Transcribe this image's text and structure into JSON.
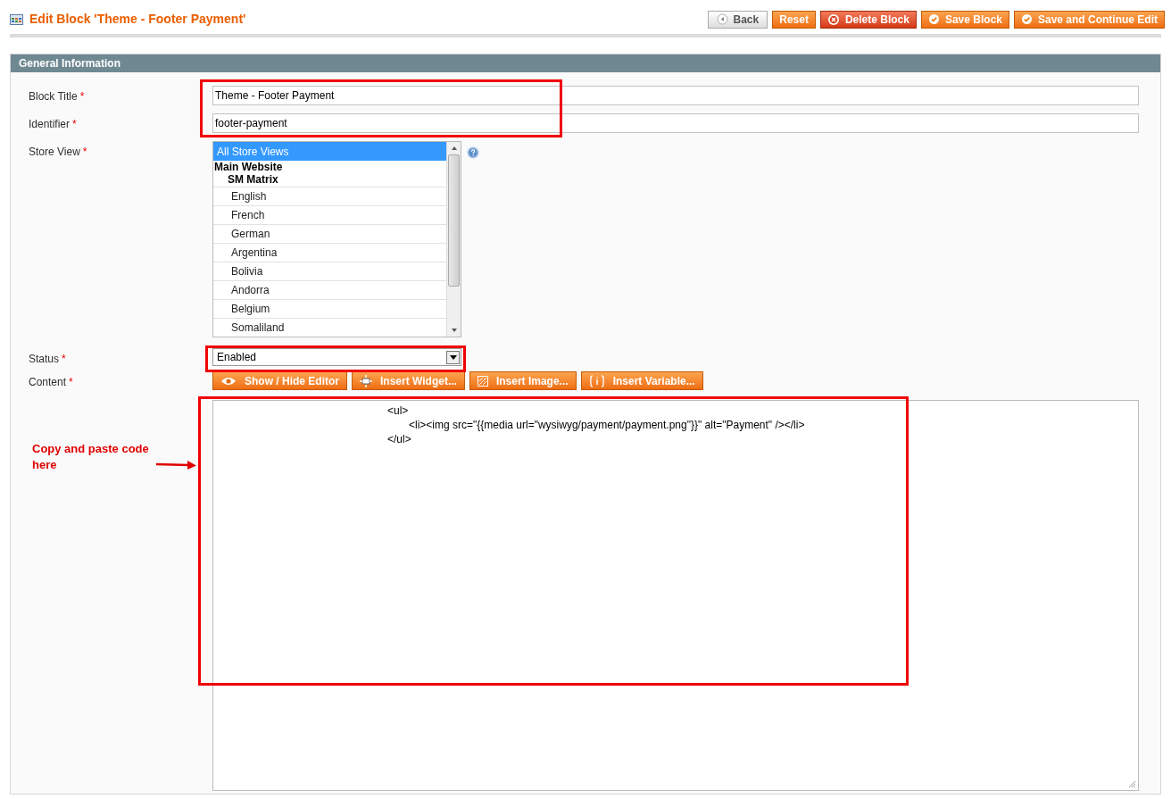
{
  "page_title": "Edit Block 'Theme - Footer Payment'",
  "buttons": [
    {
      "kind": "back",
      "label": "Back"
    },
    {
      "kind": "reset",
      "label": "Reset"
    },
    {
      "kind": "delete",
      "label": "Delete Block"
    },
    {
      "kind": "save",
      "label": "Save Block"
    },
    {
      "kind": "save",
      "label": "Save and Continue Edit"
    }
  ],
  "section": {
    "title": "General Information"
  },
  "fields": {
    "block_title": {
      "label": "Block Title",
      "required": "*",
      "value": "Theme - Footer Payment"
    },
    "identifier": {
      "label": "Identifier",
      "required": "*",
      "value": "footer-payment"
    },
    "store_view": {
      "label": "Store View",
      "required": "*",
      "options": [
        {
          "kind": "option",
          "text": "All Store Views",
          "selected": true
        },
        {
          "kind": "group",
          "text": "Main Website"
        },
        {
          "kind": "subgroup",
          "text": "SM Matrix"
        },
        {
          "kind": "option",
          "text": "English",
          "selected": false
        },
        {
          "kind": "option",
          "text": "French",
          "selected": false
        },
        {
          "kind": "option",
          "text": "German",
          "selected": false
        },
        {
          "kind": "option",
          "text": "Argentina",
          "selected": false
        },
        {
          "kind": "option",
          "text": "Bolivia",
          "selected": false
        },
        {
          "kind": "option",
          "text": "Andorra",
          "selected": false
        },
        {
          "kind": "option",
          "text": "Belgium",
          "selected": false
        },
        {
          "kind": "option",
          "text": "Somaliland",
          "selected": false
        }
      ]
    },
    "status": {
      "label": "Status",
      "required": "*",
      "value": "Enabled"
    },
    "content": {
      "label": "Content",
      "required": "*",
      "editor_buttons": [
        {
          "kind": "eye",
          "label": "Show / Hide Editor"
        },
        {
          "kind": "widget",
          "label": "Insert Widget..."
        },
        {
          "kind": "image",
          "label": "Insert Image..."
        },
        {
          "kind": "variable",
          "label": "Insert Variable..."
        }
      ],
      "lines": [
        {
          "text": "<ul>",
          "children": [
            {
              "text": "<li><img src=\"{{media url=\"wysiwyg/payment/payment.png\"}}\" alt=\"Payment\" /></li>"
            }
          ]
        },
        {
          "text": "</ul>"
        }
      ]
    }
  },
  "annotation": {
    "text": "Copy and paste code here"
  }
}
